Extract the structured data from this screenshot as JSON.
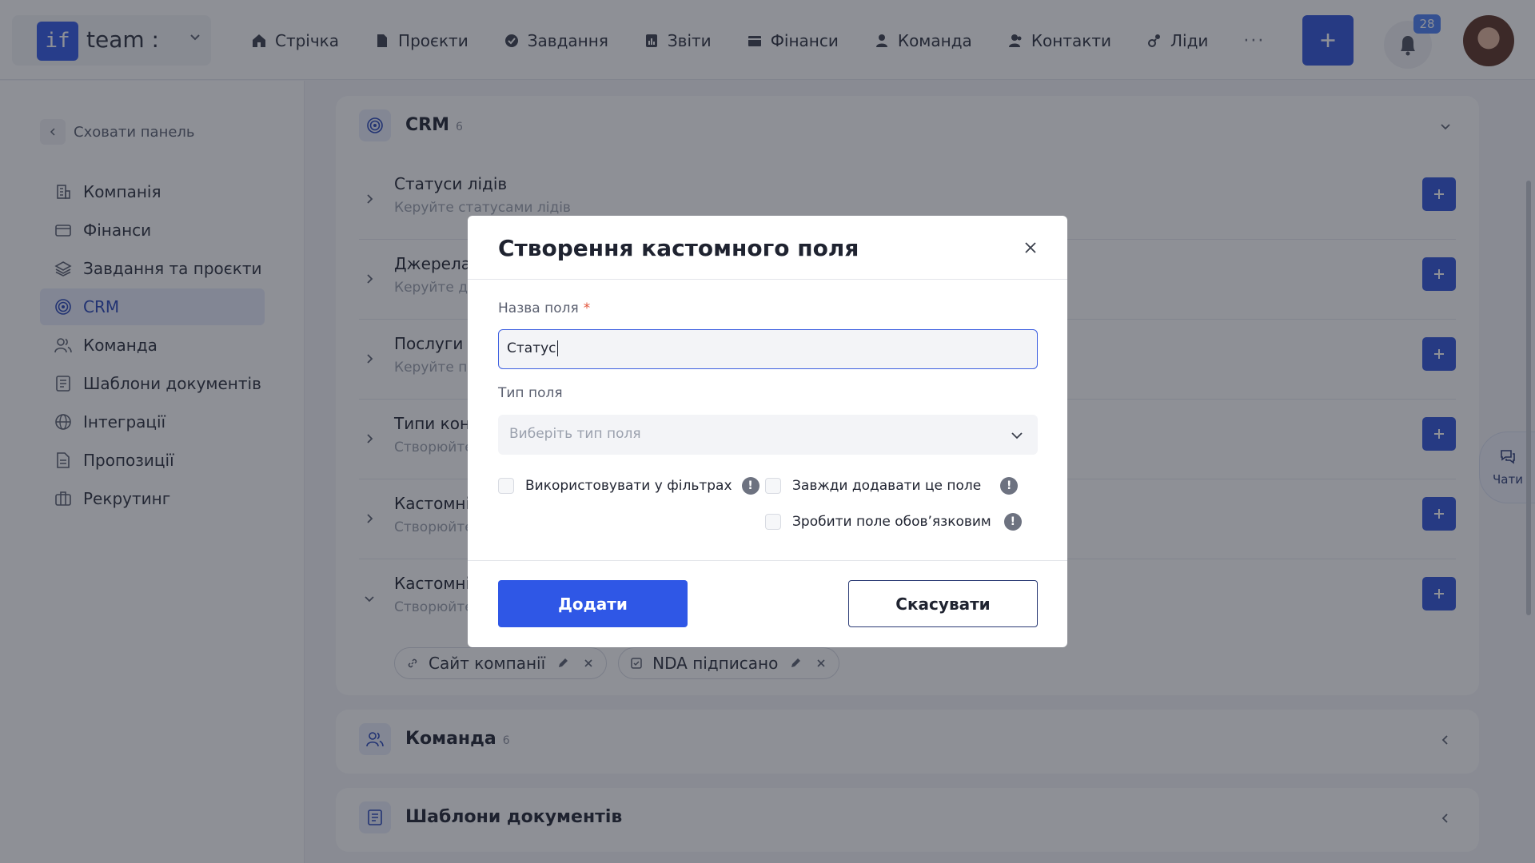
{
  "header": {
    "team_name": "team :",
    "logo_text": "if",
    "nav": [
      {
        "label": "Стрічка",
        "icon": "home-icon"
      },
      {
        "label": "Проєкти",
        "icon": "document-icon"
      },
      {
        "label": "Завдання",
        "icon": "check-circle-icon"
      },
      {
        "label": "Звіти",
        "icon": "report-icon"
      },
      {
        "label": "Фінанси",
        "icon": "wallet-icon"
      },
      {
        "label": "Команда",
        "icon": "user-icon"
      },
      {
        "label": "Контакти",
        "icon": "contacts-icon"
      },
      {
        "label": "Ліди",
        "icon": "leads-icon"
      }
    ],
    "more": "···",
    "notifications_count": "28"
  },
  "sidebar": {
    "hide_label": "Сховати панель",
    "items": [
      {
        "label": "Компанія",
        "icon": "company-icon"
      },
      {
        "label": "Фінанси",
        "icon": "card-icon"
      },
      {
        "label": "Завдання та проєкти",
        "icon": "layers-icon"
      },
      {
        "label": "CRM",
        "icon": "target-icon",
        "active": true
      },
      {
        "label": "Команда",
        "icon": "team-icon"
      },
      {
        "label": "Шаблони документів",
        "icon": "template-icon"
      },
      {
        "label": "Інтеграції",
        "icon": "globe-icon"
      },
      {
        "label": "Пропозиції",
        "icon": "proposal-icon"
      },
      {
        "label": "Рекрутинг",
        "icon": "briefcase-icon"
      }
    ]
  },
  "crm": {
    "title": "CRM",
    "count": "6",
    "rows": [
      {
        "title": "Статуси лідів",
        "sub": "Керуйте статусами лідів"
      },
      {
        "title": "Джерела",
        "sub": "Керуйте дж"
      },
      {
        "title": "Послуги",
        "sub": "Керуйте по"
      },
      {
        "title": "Типи конт",
        "sub": "Створюйте"
      },
      {
        "title": "Кастомні",
        "sub": "Створюйте"
      },
      {
        "title": "Кастомні",
        "sub": "Створюйте"
      }
    ],
    "chips": [
      {
        "label": "Сайт компанії",
        "icon": "link-icon"
      },
      {
        "label": "NDA підписано",
        "icon": "checkbox-icon"
      }
    ]
  },
  "team_section": {
    "title": "Команда",
    "count": "6"
  },
  "templates_section": {
    "title": "Шаблони документів"
  },
  "chat": {
    "label": "Чати"
  },
  "modal": {
    "title": "Створення кастомного поля",
    "name_label": "Назва поля",
    "required_mark": "*",
    "name_value": "Статус",
    "type_label": "Тип поля",
    "type_placeholder": "Виберіть тип поля",
    "options": {
      "use_in_filters": "Використовувати у фільтрах",
      "always_add": "Завжди додавати це поле",
      "make_required": "Зробити поле обов’язковим"
    },
    "info_glyph": "!",
    "add_label": "Додати",
    "cancel_label": "Скасувати"
  },
  "colors": {
    "accent": "#2f57e6",
    "overlay": "rgba(30,34,46,0.5)"
  }
}
